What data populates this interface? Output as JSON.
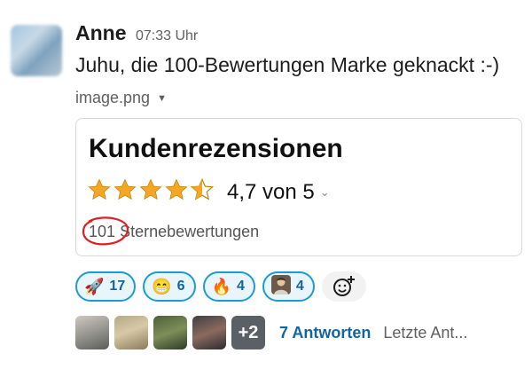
{
  "message": {
    "author": "Anne",
    "timestamp": "07:33 Uhr",
    "text": "Juhu, die 100-Bewertungen Marke geknackt :-)",
    "file_name": "image.png"
  },
  "attachment": {
    "title": "Kundenrezensionen",
    "rating_value": 4.7,
    "rating_text": "4,7 von 5",
    "review_count": "101",
    "review_label": "Sternebewertungen"
  },
  "reactions": [
    {
      "emoji": "🚀",
      "count": "17"
    },
    {
      "emoji": "😁",
      "count": "6"
    },
    {
      "emoji": "🔥",
      "count": "4"
    },
    {
      "emoji": "person-emoji",
      "count": "4"
    }
  ],
  "thread": {
    "more_count": "+2",
    "replies_label": "7 Antworten",
    "last_reply": "Letzte Ant..."
  },
  "colors": {
    "reaction_border": "#1d9bd1",
    "reaction_bg": "#e8f5fa",
    "link": "#1264a3",
    "star": "#f5a623",
    "annotation_red": "#e02020"
  }
}
